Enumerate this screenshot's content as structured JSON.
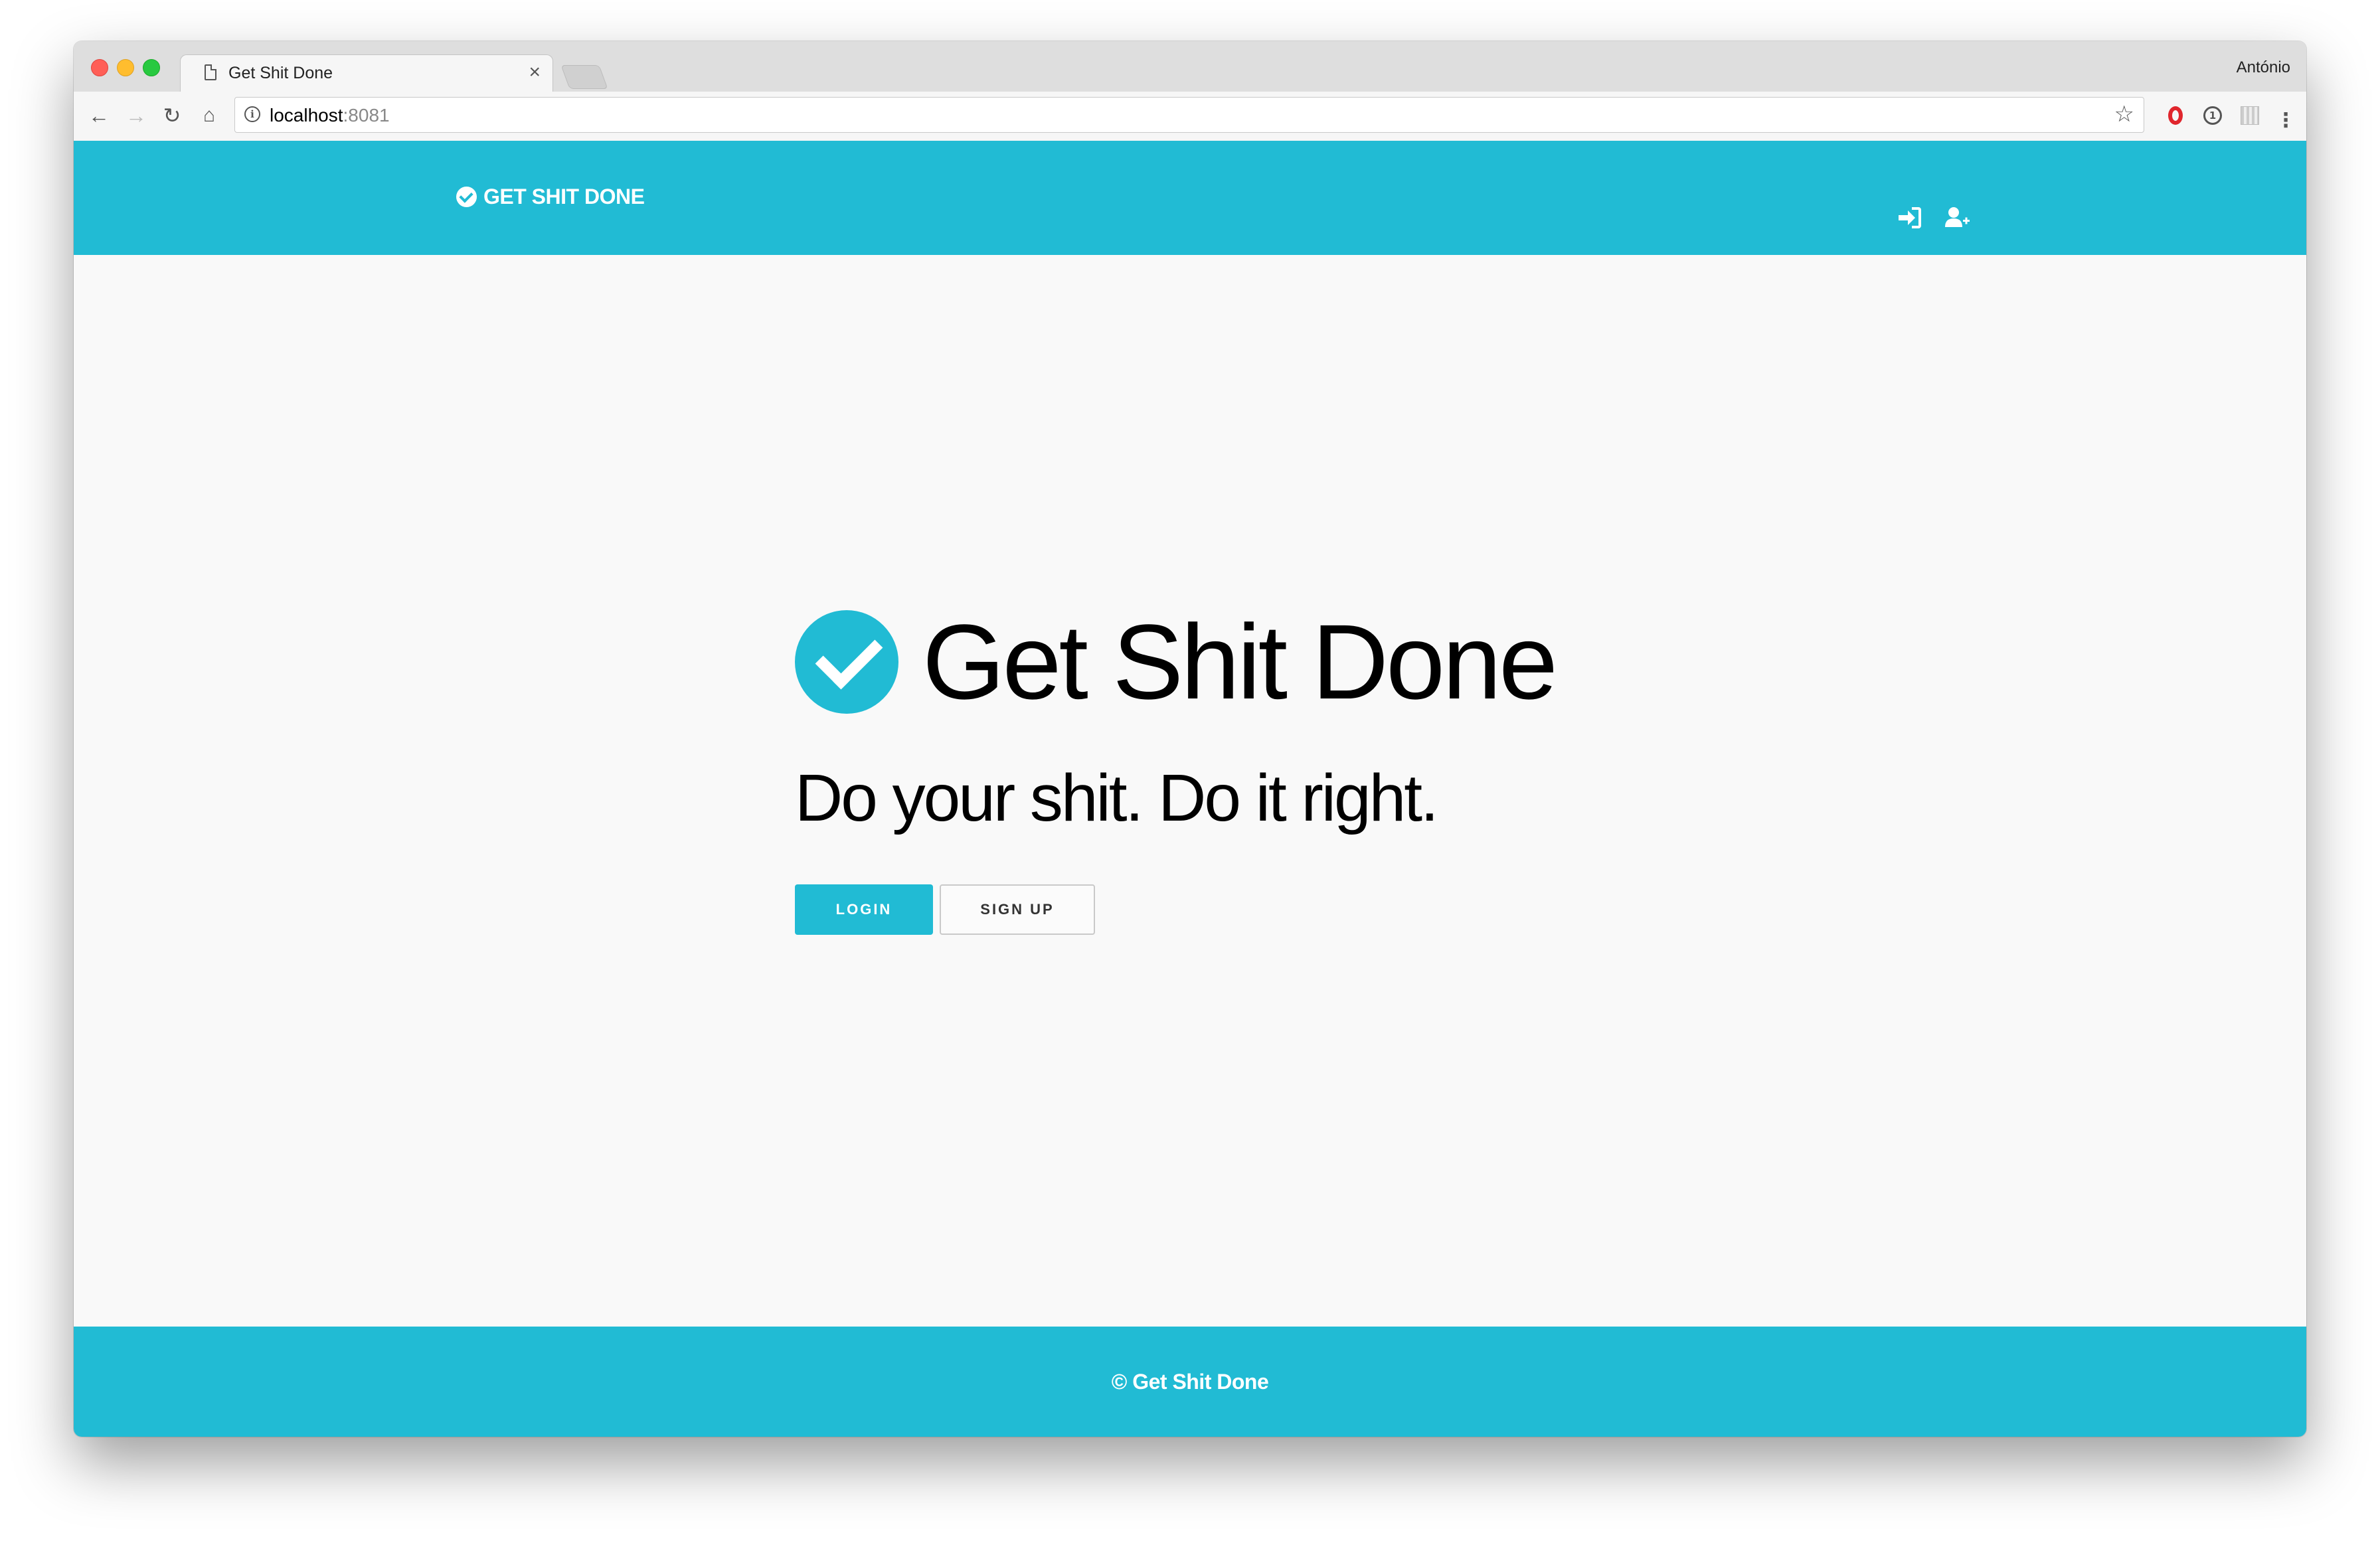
{
  "browser": {
    "tab_title": "Get Shit Done",
    "tab_close": "×",
    "profile_name": "António",
    "url_host": "localhost",
    "url_port": ":8081",
    "info_glyph": "i",
    "star_glyph": "☆",
    "menu_glyph": "⋮",
    "nav_icons": [
      "back-arrow-icon",
      "forward-arrow-icon",
      "reload-icon",
      "home-icon"
    ]
  },
  "navbar": {
    "brand": "GET SHIT DONE",
    "icons": [
      "sign-in-icon",
      "add-user-icon"
    ]
  },
  "hero": {
    "title": "Get Shit Done",
    "tagline": "Do your shit. Do it right.",
    "login_label": "LOGIN",
    "signup_label": "SIGN UP"
  },
  "footer": {
    "text": "© Get Shit Done"
  },
  "colors": {
    "brand": "#21bbd4",
    "page_background": "#f9f9f9",
    "text": "#000000"
  }
}
